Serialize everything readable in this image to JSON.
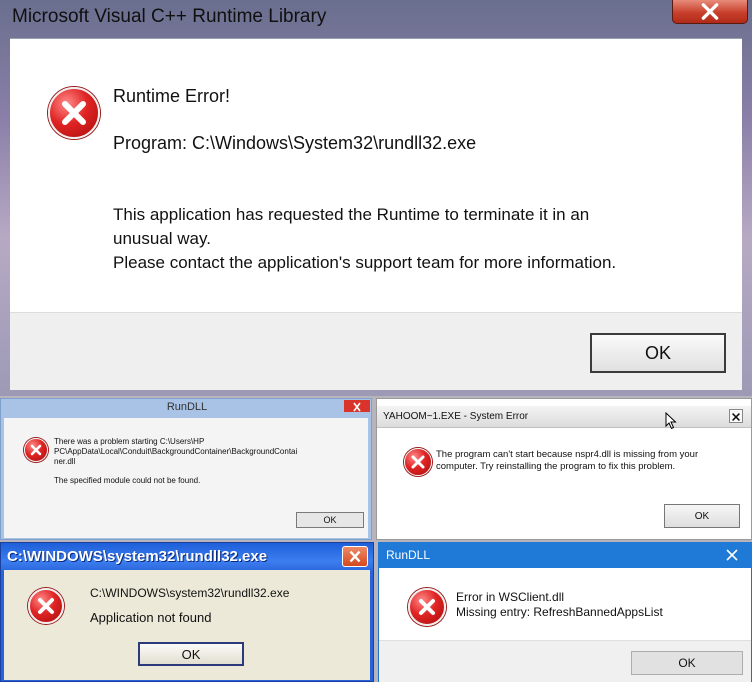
{
  "runtime_dialog": {
    "title": "Microsoft Visual C++ Runtime Library",
    "heading": "Runtime Error!",
    "program": "Program: C:\\Windows\\System32\\rundll32.exe",
    "message_line1": "This application has requested the Runtime to terminate it in an",
    "message_line2": "unusual way.",
    "message_line3": "Please contact the application's support team for more information.",
    "ok_label": "OK"
  },
  "rundll_dialog_1": {
    "title": "RunDLL",
    "message_line1": "There was a problem starting C:\\Users\\HP",
    "message_line2": "PC\\AppData\\Local\\Conduit\\BackgroundContainer\\BackgroundContai",
    "message_line3": "ner.dll",
    "message_line4": "The specified module could not be found.",
    "ok_label": "OK"
  },
  "system_error_dialog": {
    "title": "YAHOOM~1.EXE - System Error",
    "message_line1": "The program can't start because nspr4.dll is missing from your",
    "message_line2": "computer. Try reinstalling the program to fix this problem.",
    "ok_label": "OK"
  },
  "xp_dialog": {
    "title": "C:\\WINDOWS\\system32\\rundll32.exe",
    "path": "C:\\WINDOWS\\system32\\rundll32.exe",
    "message": "Application not found",
    "ok_label": "OK"
  },
  "rundll_dialog_2": {
    "title": "RunDLL",
    "message_line1": "Error in WSClient.dll",
    "message_line2": "Missing entry: RefreshBannedAppsList",
    "ok_label": "OK"
  },
  "icons": {
    "error": "error-icon",
    "close": "close-icon",
    "cursor": "mouse-cursor-icon"
  },
  "colors": {
    "error_red": "#e02424",
    "win8_titlebar": "#a8c3e6",
    "xp_titlebar": "#2862d8",
    "win10_titlebar": "#1e7ad6",
    "close_red": "#d9342b"
  }
}
